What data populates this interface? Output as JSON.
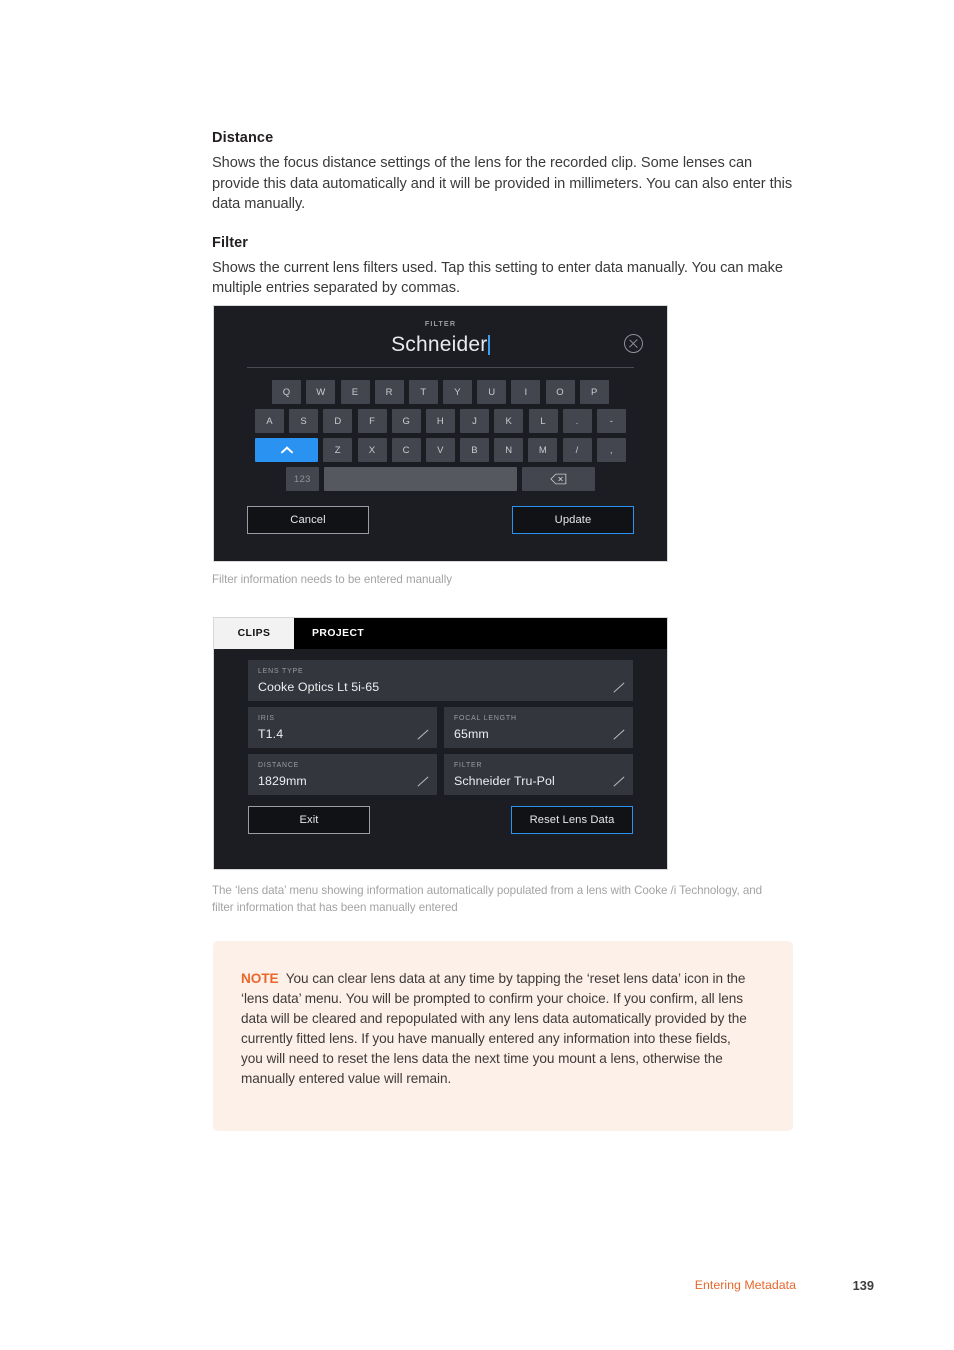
{
  "sections": [
    {
      "heading": "Distance",
      "body": "Shows the focus distance settings of the lens for the recorded clip. Some lenses can provide this data automatically and it will be provided in millimeters. You can also enter this data manually."
    },
    {
      "heading": "Filter",
      "body": "Shows the current lens filters used. Tap this setting to enter data manually. You can make multiple entries separated by commas."
    }
  ],
  "filter_dialog": {
    "title": "FILTER",
    "value": "Schneider",
    "close_icon": "close-circle-icon",
    "keyboard": {
      "row1": [
        "Q",
        "W",
        "E",
        "R",
        "T",
        "Y",
        "U",
        "I",
        "O",
        "P"
      ],
      "row2": [
        "A",
        "S",
        "D",
        "F",
        "G",
        "H",
        "J",
        "K",
        "L",
        ".",
        "-"
      ],
      "row3_shift": "shift-up-icon",
      "row3": [
        "Z",
        "X",
        "C",
        "V",
        "B",
        "N",
        "M",
        "/",
        ","
      ],
      "numeric_label": "123",
      "space_label": "",
      "backspace_icon": "backspace-icon"
    },
    "cancel_label": "Cancel",
    "update_label": "Update"
  },
  "caption1": "Filter information needs to be entered manually",
  "lens_panel": {
    "tabs": [
      {
        "label": "CLIPS",
        "active": true
      },
      {
        "label": "PROJECT",
        "active": false
      }
    ],
    "fields": [
      {
        "label": "LENS TYPE",
        "value": "Cooke Optics Lt 5i-65"
      },
      {
        "label": "IRIS",
        "value": "T1.4"
      },
      {
        "label": "FOCAL LENGTH",
        "value": "65mm"
      },
      {
        "label": "DISTANCE",
        "value": "1829mm"
      },
      {
        "label": "FILTER",
        "value": "Schneider Tru-Pol"
      }
    ],
    "exit_label": "Exit",
    "reset_label": "Reset Lens Data"
  },
  "caption2": "The ‘lens data’ menu showing information automatically populated from a lens with Cooke /i Technology, and filter information that has been manually entered",
  "note": {
    "label": "NOTE",
    "body": "You can clear lens data at any time by tapping the ‘reset lens data’ icon in the ‘lens data’ menu. You will be prompted to confirm your choice. If you confirm, all lens data will be cleared and repopulated with any lens data automatically provided by the currently fitted lens. If you have manually entered any information into these fields, you will need to reset the lens data the next time you mount a lens, otherwise the manually entered value will remain."
  },
  "footer": {
    "section": "Entering Metadata",
    "page": "139"
  },
  "colors": {
    "accent_orange": "#e8682c",
    "accent_blue": "#2a93f2",
    "note_bg": "#fdf0e8",
    "panel_bg": "#1b1d22",
    "field_bg": "#33363d"
  }
}
